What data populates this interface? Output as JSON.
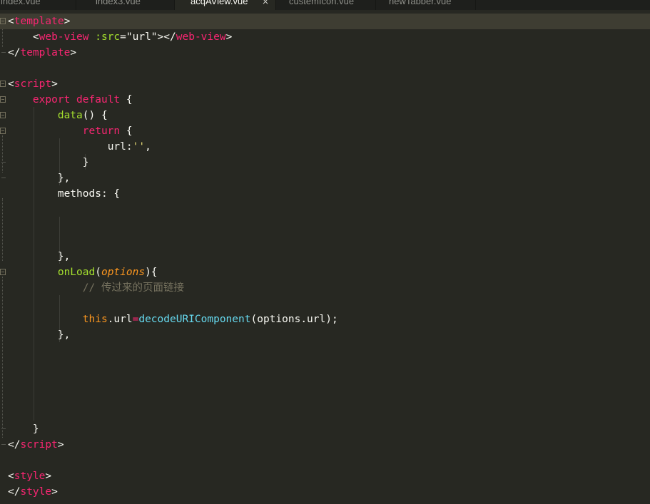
{
  "tabs": [
    {
      "label": "index.vue",
      "active": false
    },
    {
      "label": "index3.vue",
      "active": false
    },
    {
      "label": "acqAView.vue",
      "active": true,
      "close": "×"
    },
    {
      "label": "custemIcon.vue",
      "active": false
    },
    {
      "label": "newTabber.vue",
      "active": false
    }
  ],
  "code": {
    "line1": {
      "lt": "<",
      "tag": "template",
      "gt": ">"
    },
    "line2": {
      "indent": "    ",
      "lt": "<",
      "tag": "web-view",
      "attr": " :src",
      "eq": "=",
      "val": "\"url\"",
      "gt": "></",
      "tag2": "web-view",
      "gt2": ">"
    },
    "line3": {
      "lt": "</",
      "tag": "template",
      "gt": ">"
    },
    "line5": {
      "lt": "<",
      "tag": "script",
      "gt": ">"
    },
    "line6": {
      "indent": "    ",
      "kw1": "export",
      "sp": " ",
      "kw2": "default",
      "rest": " {"
    },
    "line7": {
      "indent": "        ",
      "fn": "data",
      "rest": "() {"
    },
    "line8": {
      "indent": "            ",
      "kw": "return",
      "rest": " {"
    },
    "line9": {
      "indent": "                ",
      "key": "url:",
      "str": "''",
      "rest": ","
    },
    "line10": {
      "indent": "            ",
      "rest": "}"
    },
    "line11": {
      "indent": "        ",
      "rest": "},"
    },
    "line12": {
      "indent": "        ",
      "rest": "methods: {"
    },
    "line16": {
      "indent": "        ",
      "rest": "},"
    },
    "line17": {
      "indent": "        ",
      "fn": "onLoad",
      "p1": "(",
      "param": "options",
      "p2": "){"
    },
    "line18": {
      "indent": "            ",
      "comment": "// 传过来的页面链接"
    },
    "line20": {
      "indent": "            ",
      "this": "this",
      "prop": ".url",
      "op": "=",
      "builtin": "decodeURIComponent",
      "rest": "(options.url);"
    },
    "line21": {
      "indent": "        ",
      "rest": "},"
    },
    "line27": {
      "indent": "    ",
      "rest": "}"
    },
    "line28": {
      "lt": "</",
      "tag": "script",
      "gt": ">"
    },
    "line30": {
      "lt": "<",
      "tag": "style",
      "gt": ">"
    },
    "line31": {
      "lt": "</",
      "tag": "style",
      "gt": ">"
    }
  },
  "colors": {
    "background": "#272822",
    "tag": "#f92672",
    "attribute": "#a6e22e",
    "string": "#e6db74",
    "keyword": "#f92672",
    "function": "#a6e22e",
    "parameter": "#fd971f",
    "builtin": "#66d9ef",
    "comment": "#75715e",
    "text": "#f8f8f2"
  },
  "icons": [
    "fold-icon",
    "close-icon"
  ]
}
